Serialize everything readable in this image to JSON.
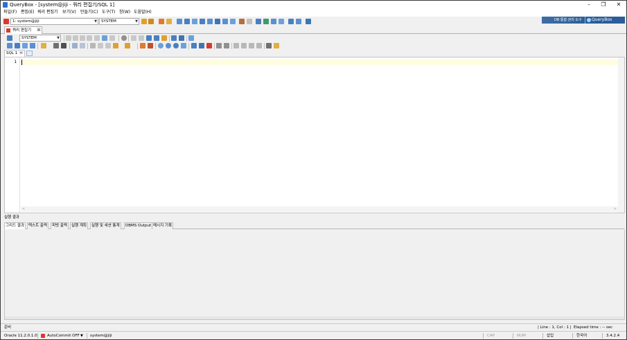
{
  "window": {
    "title": "QueryBox - [system@jiji - 쿼리 편집기/SQL 1]",
    "min_glyph": "–",
    "max_glyph": "❐",
    "close_glyph": "✕"
  },
  "menu": {
    "items": [
      "파일(F)",
      "편집(E)",
      "쿼리 편집기",
      "보기(V)",
      "만들기(C)",
      "도구(T)",
      "창(W)",
      "도움말(H)"
    ]
  },
  "connection": {
    "selected": "1: system@jiji",
    "schema": "SYSTEM"
  },
  "brand": {
    "tagline": "DB 통합 관리 도구",
    "logo_text": "QueryBox"
  },
  "doc_tab": {
    "label": "쿼리 편집기",
    "close": "⌘"
  },
  "editor_toolbar": {
    "schema": "SYSTEM"
  },
  "sql_tabs": {
    "active": "SQL 1",
    "close": "⌘"
  },
  "editor": {
    "line_numbers": [
      "1"
    ]
  },
  "results": {
    "title": "실행 결과",
    "tabs": [
      "그리드 결과",
      "텍스트 출력",
      "피벗 출력",
      "실행 계획",
      "실행 및 세션 통계",
      "DBMS Output",
      "메시지 기록"
    ]
  },
  "status": {
    "ready": "준비",
    "position": "| Line : 1, Col : 1 |",
    "elapsed": "Elapsed time : -- sec",
    "db_version": "Oracle 11.2.0.1.0",
    "autocommit": "AutoCommit OFF",
    "user": "system@jiji",
    "cap": "CAP",
    "num": "NUM",
    "insert_mode": "삽입",
    "language": "한국어",
    "version": "3.4.2.4"
  },
  "colors": {
    "accent": "#2a5d99",
    "error_red": "#d83a2a",
    "current_line": "#fffde0"
  }
}
